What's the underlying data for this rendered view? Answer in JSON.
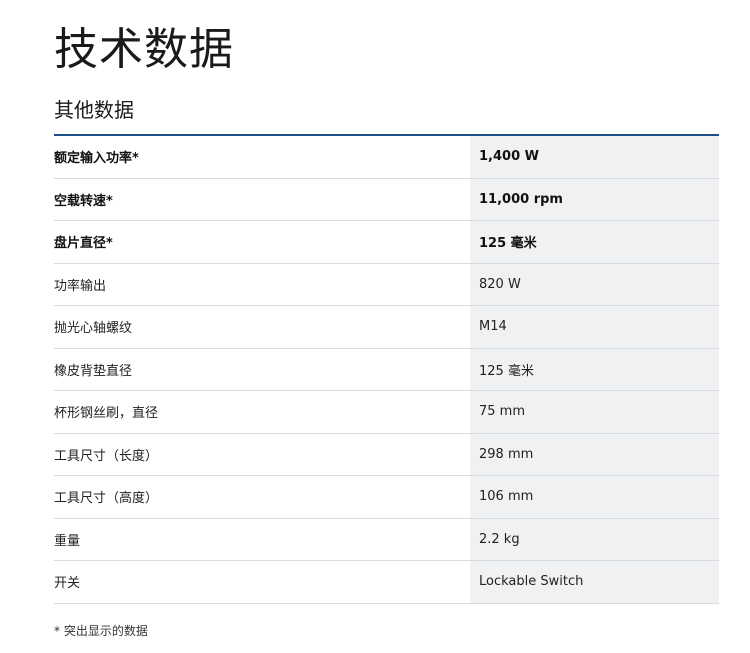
{
  "page": {
    "title": "技术数据",
    "section_title": "其他数据",
    "footnote": "* 突出显示的数据"
  },
  "specs": [
    {
      "label": "额定输入功率*",
      "value": "1,400 W",
      "highlighted": true
    },
    {
      "label": "空载转速*",
      "value": "11,000 rpm",
      "highlighted": true
    },
    {
      "label": "盘片直径*",
      "value": "125 毫米",
      "highlighted": true
    },
    {
      "label": "功率输出",
      "value": "820 W",
      "highlighted": false
    },
    {
      "label": "抛光心轴螺纹",
      "value": "M14",
      "highlighted": false
    },
    {
      "label": "橡皮背垫直径",
      "value": "125 毫米",
      "highlighted": false
    },
    {
      "label": "杯形钢丝刷，直径",
      "value": "75 mm",
      "highlighted": false
    },
    {
      "label": "工具尺寸（长度）",
      "value": "298 mm",
      "highlighted": false
    },
    {
      "label": "工具尺寸（高度）",
      "value": "106 mm",
      "highlighted": false
    },
    {
      "label": "重量",
      "value": "2.2 kg",
      "highlighted": false
    },
    {
      "label": "开关",
      "value": "Lockable Switch",
      "highlighted": false
    }
  ],
  "colors": {
    "accent_rule": "#1b4f8a",
    "value_background": "#eff1f2",
    "row_divider": "#d9dcdf"
  }
}
